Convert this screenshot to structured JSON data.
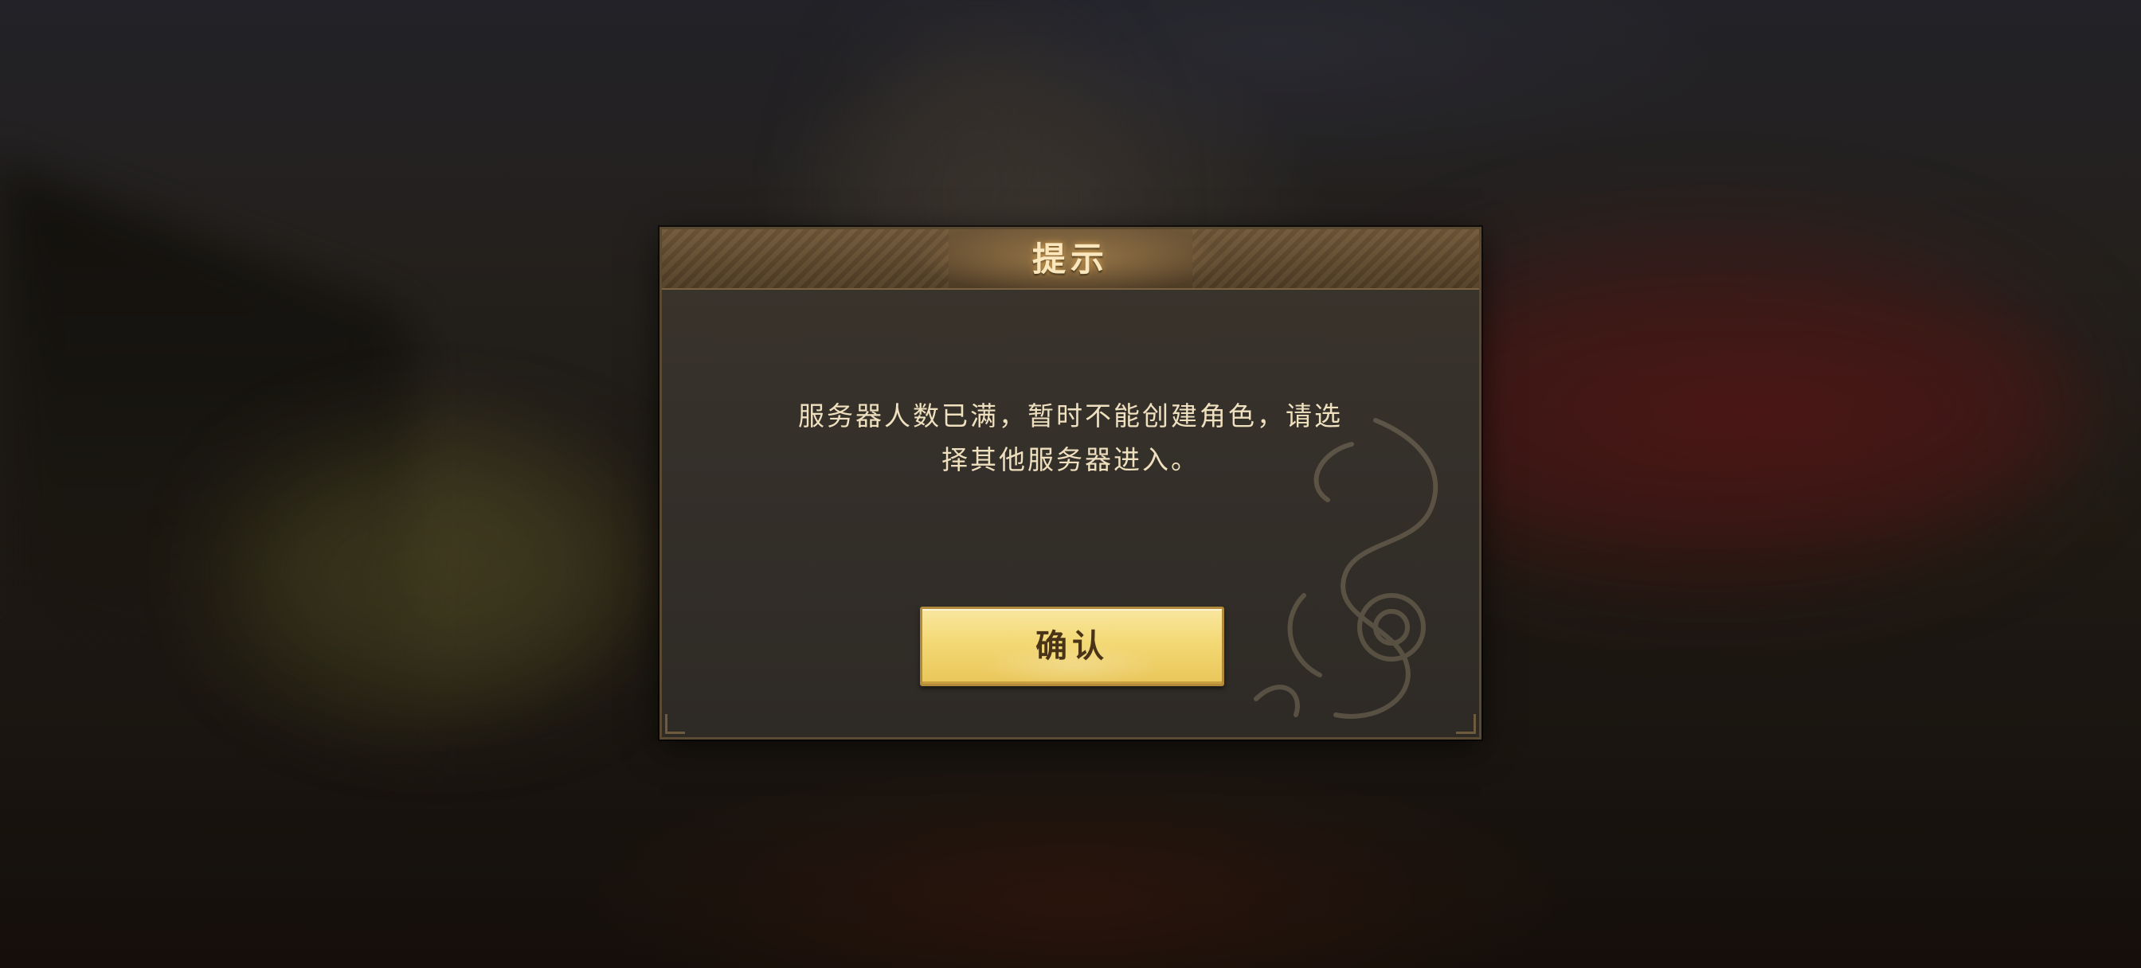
{
  "dialog": {
    "title": "提示",
    "message_line1": "服务器人数已满，暂时不能创建角色，请选",
    "message_line2": "择其他服务器进入。",
    "confirm_label": "确认"
  },
  "colors": {
    "header_gold": "#6e5638",
    "panel": "#35302a",
    "title_text": "#fbe7bd",
    "message_text": "#efe0bf",
    "button_gold": "#f3d874",
    "button_text": "#4a3418"
  },
  "icons": [
    "dragon-watermark-icon"
  ]
}
